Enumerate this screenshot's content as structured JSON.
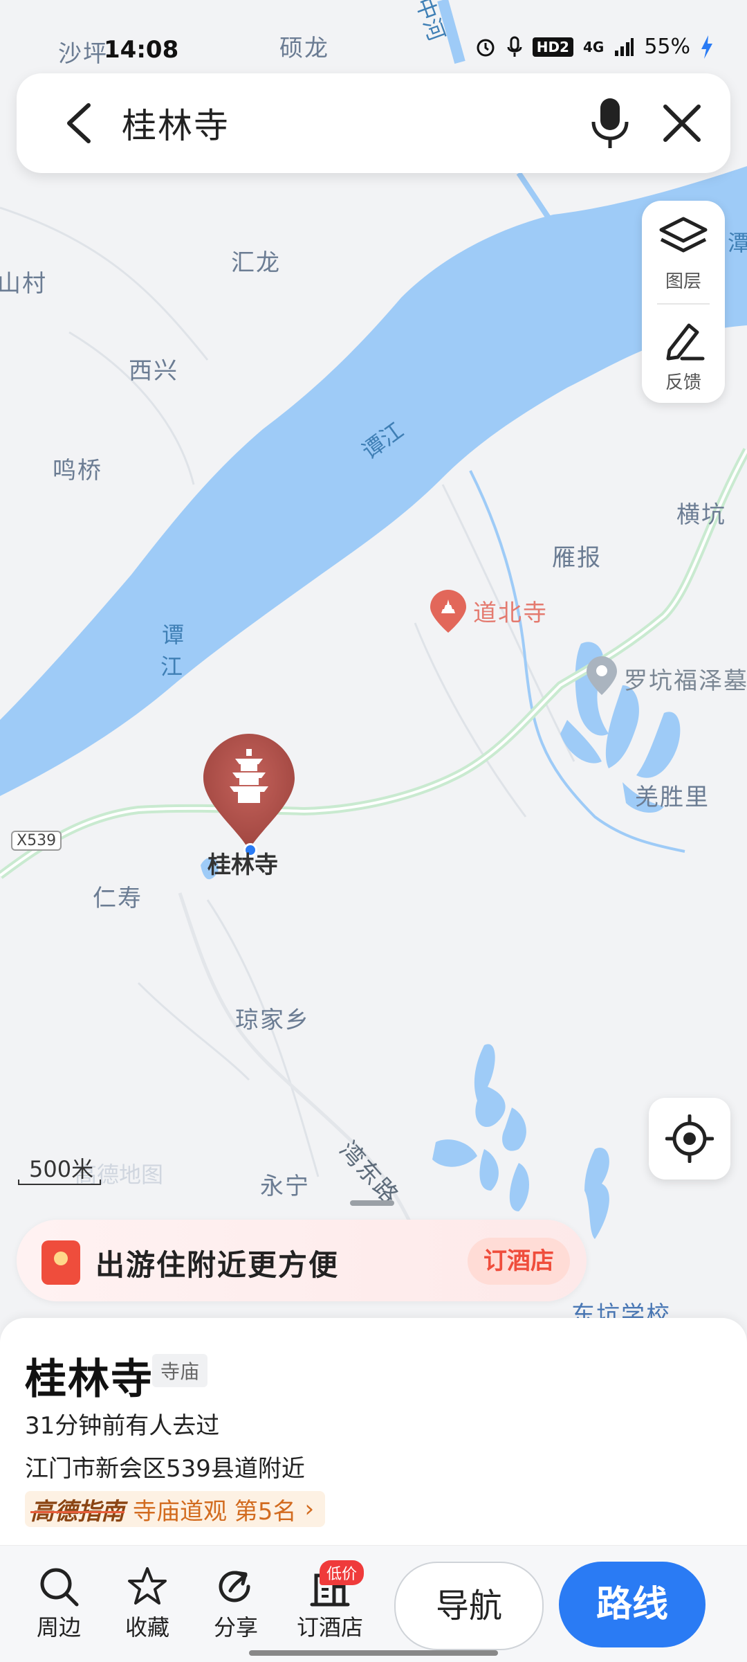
{
  "status_bar": {
    "time": "14:08",
    "network": "4G",
    "hd": "HD2",
    "battery": "55%"
  },
  "search": {
    "query": "桂林寺"
  },
  "map_tools": {
    "layers_label": "图层",
    "feedback_label": "反馈"
  },
  "map": {
    "places": [
      "沙坪",
      "硕龙",
      "汇龙",
      "山村",
      "西兴",
      "鸣桥",
      "横坑",
      "雁报",
      "罗坑福泽墓",
      "羌胜里",
      "仁寿",
      "琼家乡",
      "永宁",
      "东坑学校"
    ],
    "rivers": [
      "谭江",
      "谭",
      "江",
      "中河",
      "潭"
    ],
    "road_badge": "X539",
    "road_name": "湾东路",
    "poi_secondary": "道北寺",
    "selected_poi": "桂林寺",
    "scale": "500米",
    "watermark": "高德地图"
  },
  "promo": {
    "text": "出游住附近更方便",
    "button": "订酒店"
  },
  "place_card": {
    "name": "桂林寺",
    "category": "寺庙",
    "visit_info": "31分钟前有人去过",
    "address": "江门市新会区539县道附近",
    "guide_brand": "高德指南",
    "guide_rank": "寺庙道观 第5名"
  },
  "bottom_bar": {
    "nearby": "周边",
    "favorite": "收藏",
    "share": "分享",
    "hotel": "订酒店",
    "hotel_badge": "低价",
    "navigate": "导航",
    "route": "路线"
  },
  "colors": {
    "water": "#9ecbf7",
    "road": "#c9ead0",
    "accent": "#2a7bf4",
    "poi": "#b3504a"
  }
}
